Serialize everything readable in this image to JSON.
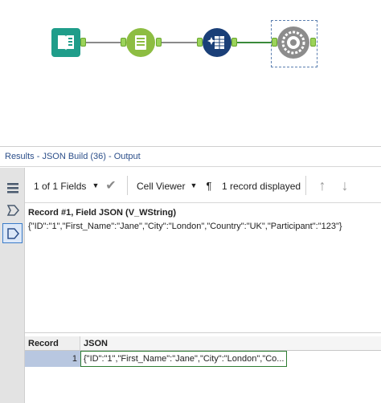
{
  "canvas": {
    "tools": [
      {
        "name": "input-data-tool",
        "icon": "book-icon"
      },
      {
        "name": "select-tool",
        "icon": "list-icon"
      },
      {
        "name": "formula-tool",
        "icon": "sparkle-grid-icon"
      },
      {
        "name": "json-build-tool",
        "icon": "gear-icon"
      }
    ]
  },
  "results": {
    "title": "Results - JSON Build (36) - Output",
    "toolbar": {
      "fields_label": "1 of 1 Fields",
      "cell_viewer_label": "Cell Viewer",
      "records_label": "1 record displayed"
    },
    "record_panel": {
      "label": "Record #1, Field JSON (V_WString)",
      "value": "{\"ID\":\"1\",\"First_Name\":\"Jane\",\"City\":\"London\",\"Country\":\"UK\",\"Participant\":\"123\"}"
    },
    "grid": {
      "columns": [
        "Record",
        "JSON"
      ],
      "rows": [
        {
          "record": "1",
          "json": "{\"ID\":\"1\",\"First_Name\":\"Jane\",\"City\":\"London\",\"Co..."
        }
      ]
    }
  },
  "colors": {
    "input_tool": "#1f9d8a",
    "select_tool": "#8dbd42",
    "formula_tool": "#1a3f78",
    "json_build_tool": "#8c8c8c",
    "title_text": "#2c4f8a",
    "selected_row": "#b8c7e0",
    "active_cell_border": "#2e7d32"
  }
}
